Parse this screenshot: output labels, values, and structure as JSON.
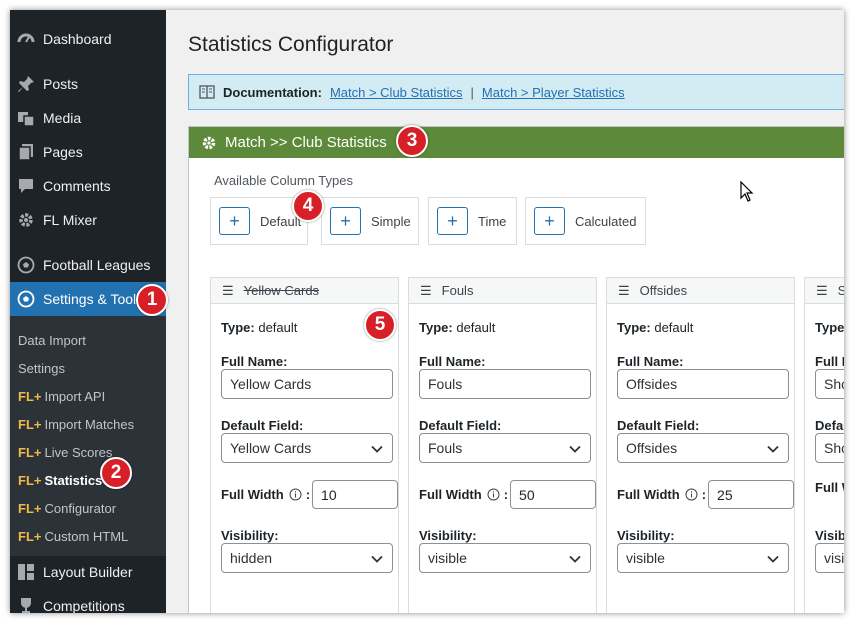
{
  "sidebar": {
    "menu": [
      {
        "label": "Dashboard",
        "icon": "dashboard-icon"
      },
      {
        "label": "Posts",
        "icon": "pin-icon"
      },
      {
        "label": "Media",
        "icon": "media-icon"
      },
      {
        "label": "Pages",
        "icon": "pages-icon"
      },
      {
        "label": "Comments",
        "icon": "comment-icon"
      },
      {
        "label": "FL Mixer",
        "icon": "gear-icon"
      },
      {
        "label": "Football Leagues",
        "icon": "soccer-ball-icon"
      },
      {
        "label": "Settings & Tools",
        "icon": "soccer-ball-icon"
      },
      {
        "label": "Layout Builder",
        "icon": "layout-icon"
      },
      {
        "label": "Competitions",
        "icon": "trophy-icon"
      }
    ],
    "submenu": [
      {
        "prefix": "",
        "label": "Data Import"
      },
      {
        "prefix": "",
        "label": "Settings"
      },
      {
        "prefix": "FL+",
        "label": "Import API"
      },
      {
        "prefix": "FL+",
        "label": "Import Matches"
      },
      {
        "prefix": "FL+",
        "label": "Live Scores"
      },
      {
        "prefix": "FL+",
        "label": "Statistics"
      },
      {
        "prefix": "FL+",
        "label": "Configurator"
      },
      {
        "prefix": "FL+",
        "label": "Custom HTML"
      }
    ]
  },
  "page": {
    "title": "Statistics Configurator",
    "doc": {
      "label": "Documentation:",
      "link1": "Match > Club Statistics",
      "separator": "|",
      "link2": "Match > Player Statistics"
    },
    "panel_title": "Match >> Club Statistics",
    "available_label": "Available Column Types",
    "column_types": [
      "Default",
      "Simple",
      "Time",
      "Calculated"
    ],
    "labels": {
      "type": "Type:",
      "full_name": "Full Name:",
      "default_field": "Default Field:",
      "full_width": "Full Width",
      "visibility": "Visibility:"
    },
    "columns": [
      {
        "title": "Yellow Cards",
        "type": "default",
        "full_name": "Yellow Cards",
        "default_field": "Yellow Cards",
        "full_width": "10",
        "visibility": "hidden"
      },
      {
        "title": "Fouls",
        "type": "default",
        "full_name": "Fouls",
        "default_field": "Fouls",
        "full_width": "50",
        "visibility": "visible"
      },
      {
        "title": "Offsides",
        "type": "default",
        "full_name": "Offsides",
        "default_field": "Offsides",
        "full_width": "25",
        "visibility": "visible"
      },
      {
        "title": "S",
        "type": "",
        "full_name": "Sho",
        "default_field": "Sho",
        "full_width": "",
        "visibility": "visi"
      }
    ]
  },
  "badges": [
    "1",
    "2",
    "3",
    "4",
    "5"
  ],
  "colors": {
    "sidebar_bg": "#1d2327",
    "active_menu": "#2271b1",
    "panel_header": "#5c8a3a",
    "badge": "#d61f26",
    "doc_bg": "#d3ebf3"
  }
}
